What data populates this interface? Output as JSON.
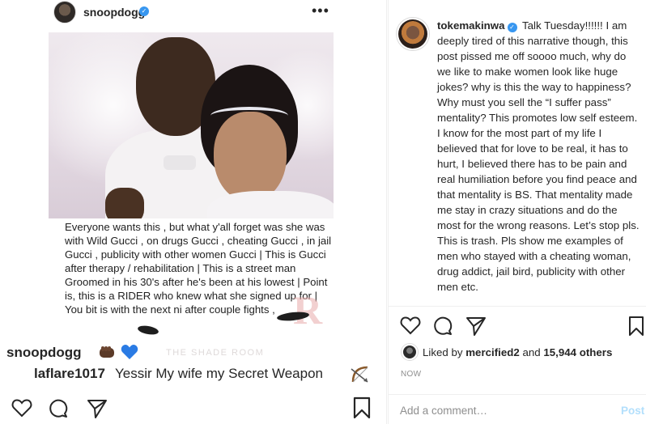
{
  "left_panel": {
    "header": {
      "username": "snoopdogg",
      "more_icon": "•••"
    },
    "image_caption": "Everyone wants this , but what y'all forget was she was with Wild Gucci , on drugs Gucci , cheating Gucci , in jail Gucci , publicity with other women Gucci | This is Gucci after therapy / rehabilitation | This is a street man Groomed in his 30's after he's been at his lowest | Point is, this is a RIDER who knew what she signed up for | You bit is with the next ni after couple fights ,",
    "watermark": "THE SHADE ROOM",
    "watermark_r": "R",
    "comments": [
      {
        "user": "snoopdogg",
        "icons": [
          "fist-emoji",
          "blue-heart-emoji"
        ]
      },
      {
        "user": "laflare1017",
        "text": "Yessir My wife my Secret Weapon",
        "icons": [
          "bow-and-arrow-emoji"
        ]
      }
    ]
  },
  "right_panel": {
    "username": "tokemakinwa",
    "caption": "Talk Tuesday!!!!!! I am deeply tired of this narrative though, this post pissed me off soooo much, why do we like to make women look like huge jokes? why is this the way to happiness? Why must you sell the “I suffer pass” mentality? This promotes low self esteem. I know for the most part of my life I believed that for love to be real, it has to hurt, I believed there has to be pain and real humiliation before you find peace and that mentality is BS. That mentality made me stay in crazy situations and do the most for the wrong reasons. Let’s stop pls. This is trash. Pls show me examples of men who stayed with a cheating woman, drug addict, jail bird, publicity with other men etc.",
    "likes": {
      "prefix": "Liked by",
      "user": "mercified2",
      "and": "and",
      "count": "15,944 others"
    },
    "timestamp": "NOW",
    "add_comment_placeholder": "Add a comment…",
    "post_label": "Post"
  },
  "colors": {
    "verified": "#3897f0",
    "post_disabled": "#b2dffc",
    "muted_text": "#8e8e8e"
  }
}
